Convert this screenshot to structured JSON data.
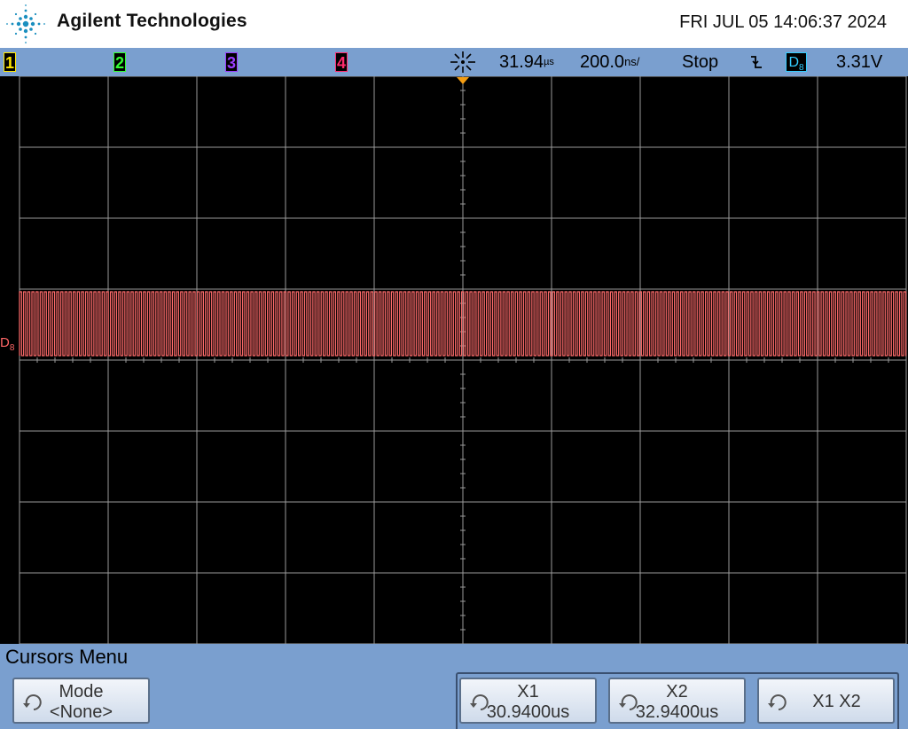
{
  "header": {
    "brand": "Agilent Technologies",
    "datetime": "FRI JUL 05 14:06:37 2024",
    "logo_icon": "agilent-spark-icon"
  },
  "status": {
    "channels": [
      {
        "label": "1",
        "color": "#ffe600"
      },
      {
        "label": "2",
        "color": "#33ff33"
      },
      {
        "label": "3",
        "color": "#9b3cff"
      },
      {
        "label": "4",
        "color": "#ff2a6d"
      }
    ],
    "trigger_icon": "trigger-position-icon",
    "delay": "31.94",
    "delay_unit": "µs",
    "timebase": "200.0",
    "timebase_unit": "ns/",
    "run_state": "Stop",
    "edge_icon": "falling-edge-icon",
    "trigger_source": "D",
    "trigger_source_sub": "8",
    "trigger_level": "3.31V"
  },
  "waveform": {
    "label": "D",
    "label_sub": "8",
    "color": "#ff6b6b",
    "grid_color": "#9a9a9a"
  },
  "menu": {
    "title": "Cursors Menu",
    "softkeys": [
      {
        "name": "mode-softkey",
        "line1": "Mode",
        "line2": "<None>"
      },
      {
        "name": "x1-softkey",
        "line1": "X1",
        "line2": "30.9400us"
      },
      {
        "name": "x2-softkey",
        "line1": "X2",
        "line2": "32.9400us"
      },
      {
        "name": "x1-x2-softkey",
        "line1": "X1 X2",
        "line2": ""
      }
    ]
  }
}
